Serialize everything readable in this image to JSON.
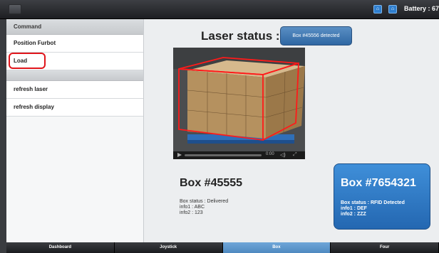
{
  "topbar": {
    "battery_label": "Battery : 67"
  },
  "sidebar": {
    "header": "Command",
    "items": [
      {
        "label": "Position Furbot"
      },
      {
        "label": "Load"
      },
      {
        "label": "refresh laser"
      },
      {
        "label": "refresh display"
      }
    ]
  },
  "main": {
    "laser_title": "Laser status :",
    "laser_badge": "Box #45556 detected",
    "video": {
      "time": "0:00",
      "progress": 0
    },
    "box1": {
      "title": "Box #45555",
      "status": "Box status : Delivered",
      "info1": "info1 : ABC",
      "info2": "info2 : 123"
    },
    "box2": {
      "title": "Box #7654321",
      "status": "Box status : RFID Detected",
      "info1": "info1 : DEF",
      "info2": "info2 : ZZZ"
    }
  },
  "tabs": [
    {
      "label": "Dashboard",
      "active": false
    },
    {
      "label": "Joystick",
      "active": false
    },
    {
      "label": "Box",
      "active": true
    },
    {
      "label": "Four",
      "active": false
    }
  ],
  "colors": {
    "accent": "#2f7fcf",
    "highlight": "#e0151b",
    "active_tab": "#5b95cc"
  }
}
